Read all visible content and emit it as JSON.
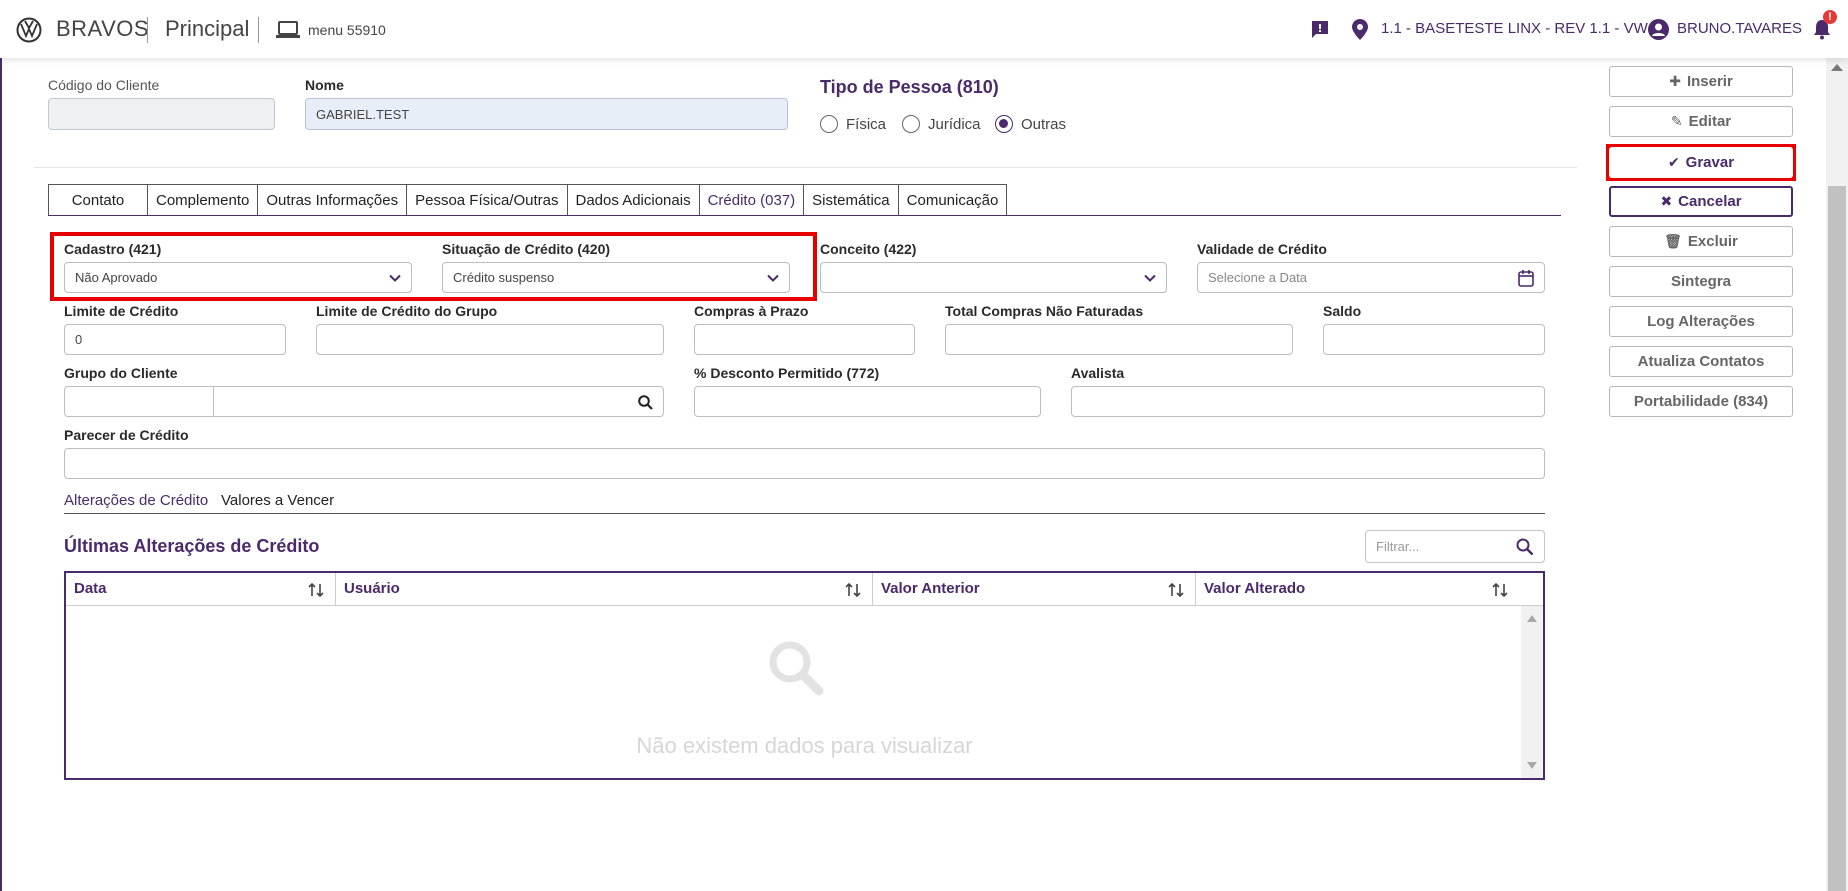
{
  "header": {
    "brand": "BRAVOS",
    "module": "Principal",
    "menu_label": "menu 55910",
    "branch": "1.1 - BASETESTE LINX - REV 1.1 - VW",
    "user": "BRUNO.TAVARES",
    "notification_badge": "!"
  },
  "form": {
    "codigo_cliente": {
      "label": "Código do Cliente",
      "value": ""
    },
    "nome": {
      "label": "Nome",
      "value": "GABRIEL.TEST"
    },
    "tipo_pessoa": {
      "title": "Tipo de Pessoa (810)",
      "options": [
        "Física",
        "Jurídica",
        "Outras"
      ],
      "selected": "Outras"
    }
  },
  "tabs": [
    "Contato",
    "Complemento",
    "Outras Informações",
    "Pessoa Física/Outras",
    "Dados Adicionais",
    "Crédito (037)",
    "Sistemática",
    "Comunicação"
  ],
  "active_tab": "Crédito (037)",
  "credito": {
    "cadastro": {
      "label": "Cadastro (421)",
      "value": "Não Aprovado"
    },
    "situacao": {
      "label": "Situação de Crédito (420)",
      "value": "Crédito suspenso"
    },
    "conceito": {
      "label": "Conceito (422)",
      "value": ""
    },
    "validade": {
      "label": "Validade de Crédito",
      "placeholder": "Selecione a Data"
    },
    "limite": {
      "label": "Limite de Crédito",
      "value": "0"
    },
    "limite_grupo": {
      "label": "Limite de Crédito do Grupo",
      "value": ""
    },
    "compras_prazo": {
      "label": "Compras à Prazo",
      "value": ""
    },
    "total_nao_faturadas": {
      "label": "Total Compras Não Faturadas",
      "value": ""
    },
    "saldo": {
      "label": "Saldo",
      "value": ""
    },
    "grupo_cliente": {
      "label": "Grupo do Cliente",
      "code": "",
      "name": ""
    },
    "desconto": {
      "label": "% Desconto Permitido (772)",
      "value": ""
    },
    "avalista": {
      "label": "Avalista",
      "value": ""
    },
    "parecer": {
      "label": "Parecer de Crédito",
      "value": ""
    }
  },
  "subtabs": [
    "Alterações de Crédito",
    "Valores a Vencer"
  ],
  "active_subtab": "Alterações de Crédito",
  "table": {
    "title": "Últimas Alterações de Crédito",
    "filter_placeholder": "Filtrar...",
    "columns": [
      "Data",
      "Usuário",
      "Valor Anterior",
      "Valor Alterado"
    ],
    "empty_message": "Não existem dados para visualizar"
  },
  "actions": [
    "Inserir",
    "Editar",
    "Gravar",
    "Cancelar",
    "Excluir",
    "Sintegra",
    "Log Alterações",
    "Atualiza Contatos",
    "Portabilidade (834)"
  ],
  "colors": {
    "primary": "#4a2a6a",
    "highlight": "#e60000"
  }
}
